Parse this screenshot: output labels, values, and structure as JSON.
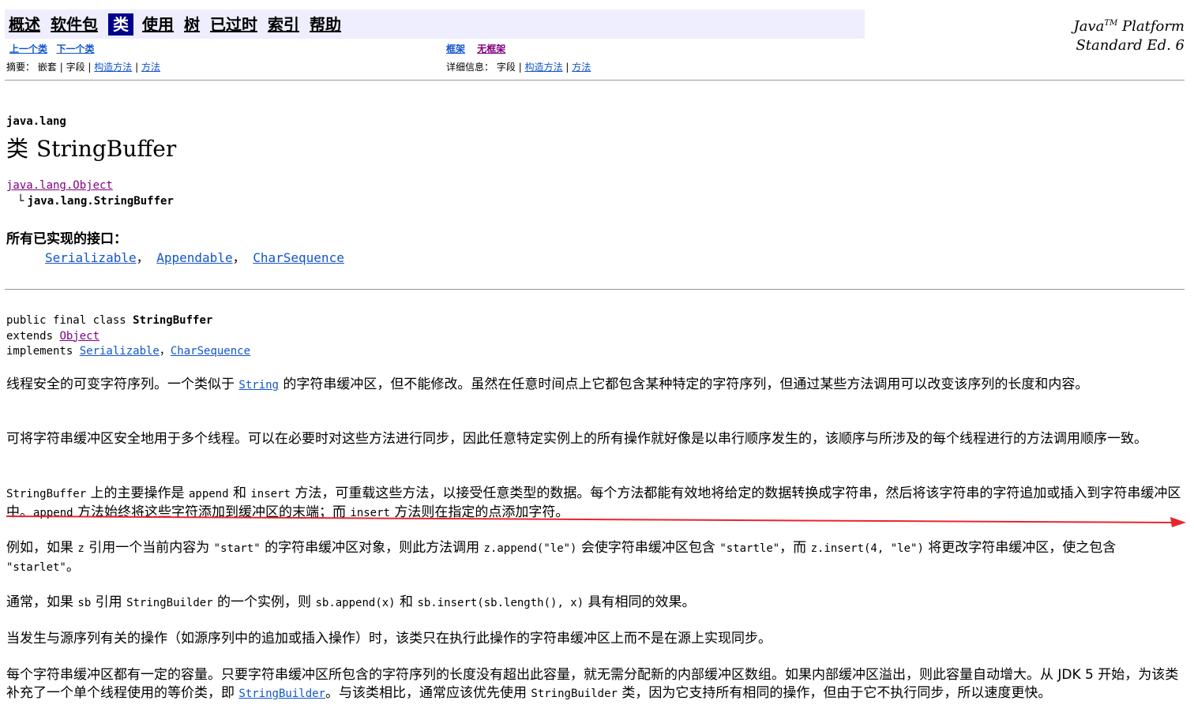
{
  "nav": {
    "items": [
      "概述",
      "软件包",
      "类",
      "使用",
      "树",
      "已过时",
      "索引",
      "帮助"
    ],
    "current": "类"
  },
  "platform": {
    "line1_prefix": "Java",
    "tm": "TM",
    "line1_suffix": " Platform",
    "line2": "Standard Ed. 6"
  },
  "subnav": {
    "prev_class": "上一个类",
    "next_class": "下一个类",
    "frames": "框架",
    "no_frames": "无框架",
    "summary_label": "摘要：",
    "summary_nested": "嵌套",
    "summary_field": "字段",
    "summary_constructor": "构造方法",
    "summary_method": "方法",
    "detail_label": "详细信息：",
    "detail_field": "字段",
    "detail_constructor": "构造方法",
    "detail_method": "方法",
    "sep": "|"
  },
  "header": {
    "package": "java.lang",
    "class_keyword": "类",
    "class_name": "StringBuffer"
  },
  "hierarchy": {
    "parent": "java.lang.Object",
    "corner": "└",
    "child": "java.lang.StringBuffer"
  },
  "interfaces": {
    "heading": "所有已实现的接口：",
    "items": [
      "Serializable",
      "Appendable",
      "CharSequence"
    ],
    "sep": "，"
  },
  "signature": {
    "line1_prefix": "public final class ",
    "line1_name": "StringBuffer",
    "line2_prefix": "extends ",
    "line2_link": "Object",
    "line3_prefix": "implements ",
    "line3_link1": "Serializable",
    "line3_sep": "，",
    "line3_link2": "CharSequence"
  },
  "paragraphs": {
    "p1_a": "线程安全的可变字符序列。一个类似于 ",
    "p1_link": "String",
    "p1_b": " 的字符串缓冲区，但不能修改。虽然在任意时间点上它都包含某种特定的字符序列，但通过某些方法调用可以改变该序列的长度和内容。",
    "p2": "可将字符串缓冲区安全地用于多个线程。可以在必要时对这些方法进行同步，因此任意特定实例上的所有操作就好像是以串行顺序发生的，该顺序与所涉及的每个线程进行的方法调用顺序一致。",
    "p3_c1": "StringBuffer",
    "p3_t1": " 上的主要操作是 ",
    "p3_c2": "append",
    "p3_t2": " 和 ",
    "p3_c3": "insert",
    "p3_t3": " 方法，可重载这些方法，以接受任意类型的数据。每个方法都能有效地将给定的数据转换成字符串，然后将该字符串的字符追加或插入到字符串缓冲区中。",
    "p3_c4": "append",
    "p3_t4": " 方法始终将这些字符添加到缓冲区的末端；而 ",
    "p3_c5": "insert",
    "p3_t5": " 方法则在指定的点添加字符。",
    "p4_t1": "例如，如果 ",
    "p4_c1": "z",
    "p4_t2": " 引用一个当前内容为 ",
    "p4_c2": "\"start\"",
    "p4_t3": " 的字符串缓冲区对象，则此方法调用 ",
    "p4_c3": "z.append(\"le\")",
    "p4_t4": " 会使字符串缓冲区包含 ",
    "p4_c4": "\"startle\"",
    "p4_t5": "，而 ",
    "p4_c5": "z.insert(4, \"le\")",
    "p4_t6": " 将更改字符串缓冲区，使之包含 ",
    "p4_c6": "\"starlet\"",
    "p4_t7": "。",
    "p5_t1": "通常，如果 ",
    "p5_c1": "sb",
    "p5_t2": " 引用 ",
    "p5_c2": "StringBuilder",
    "p5_t3": " 的一个实例，则 ",
    "p5_c3": "sb.append(x)",
    "p5_t4": " 和 ",
    "p5_c4": "sb.insert(sb.length(), x)",
    "p5_t5": " 具有相同的效果。",
    "p6": "当发生与源序列有关的操作（如源序列中的追加或插入操作）时，该类只在执行此操作的字符串缓冲区上而不是在源上实现同步。",
    "p7_t1": "每个字符串缓冲区都有一定的容量。只要字符串缓冲区所包含的字符序列的长度没有超出此容量，就无需分配新的内部缓冲区数组。如果内部缓冲区溢出，则此容量自动增大。从 JDK 5 开始，为该类补充了一个单个线程使用的等价类，即 ",
    "p7_link": "StringBuilder",
    "p7_t2": "。与该类相比，通常应该优先使用 ",
    "p7_c1": "StringBuilder",
    "p7_t3": " 类，因为它支持所有相同的操作，但由于它不执行同步，所以速度更快。"
  },
  "colors": {
    "nav_bg": "#eeeeff",
    "nav_current_bg": "#00008b",
    "link": "#1155cc",
    "visited": "#800080",
    "annotation_arrow": "#e8262e"
  }
}
